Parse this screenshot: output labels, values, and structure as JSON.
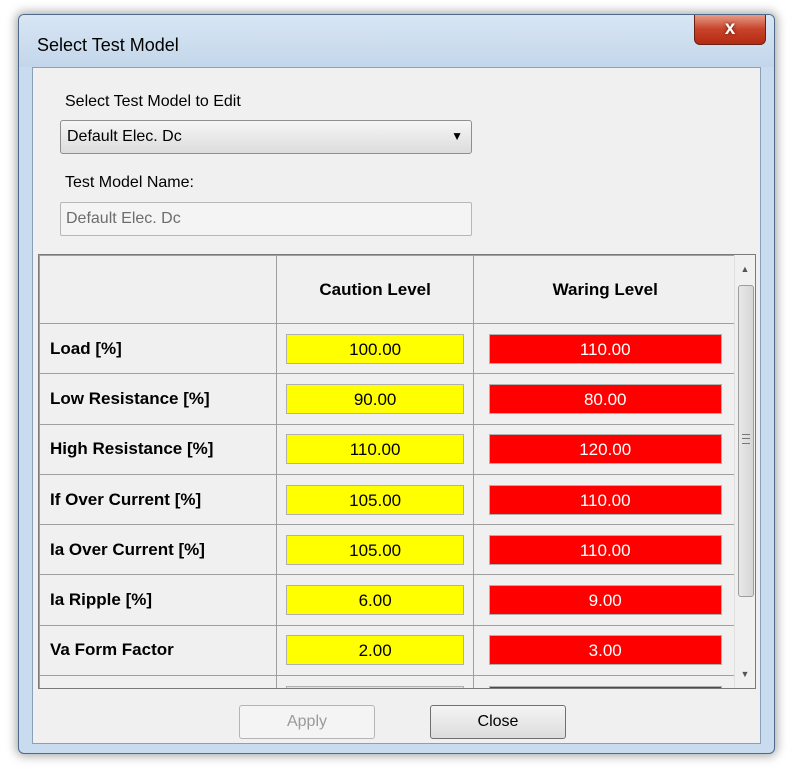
{
  "window": {
    "title": "Select Test Model",
    "close_glyph": "x"
  },
  "form": {
    "select_label": "Select Test Model to Edit",
    "selected_model": "Default Elec. Dc",
    "name_label": "Test Model Name:",
    "name_value": "Default Elec. Dc"
  },
  "grid": {
    "columns": [
      "",
      "Caution Level",
      "Waring Level"
    ],
    "rows": [
      {
        "label": "Load [%]",
        "caution": "100.00",
        "warning": "110.00"
      },
      {
        "label": "Low Resistance [%]",
        "caution": "90.00",
        "warning": "80.00"
      },
      {
        "label": "High Resistance [%]",
        "caution": "110.00",
        "warning": "120.00"
      },
      {
        "label": "If Over Current [%]",
        "caution": "105.00",
        "warning": "110.00"
      },
      {
        "label": "Ia Over Current [%]",
        "caution": "105.00",
        "warning": "110.00"
      },
      {
        "label": "Ia Ripple [%]",
        "caution": "6.00",
        "warning": "9.00"
      },
      {
        "label": "Va Form Factor",
        "caution": "2.00",
        "warning": "3.00"
      },
      {
        "label": "",
        "caution": "",
        "warning": ""
      }
    ],
    "colors": {
      "caution": "#ffff00",
      "warning": "#ff0000"
    }
  },
  "buttons": {
    "apply": "Apply",
    "close": "Close"
  }
}
